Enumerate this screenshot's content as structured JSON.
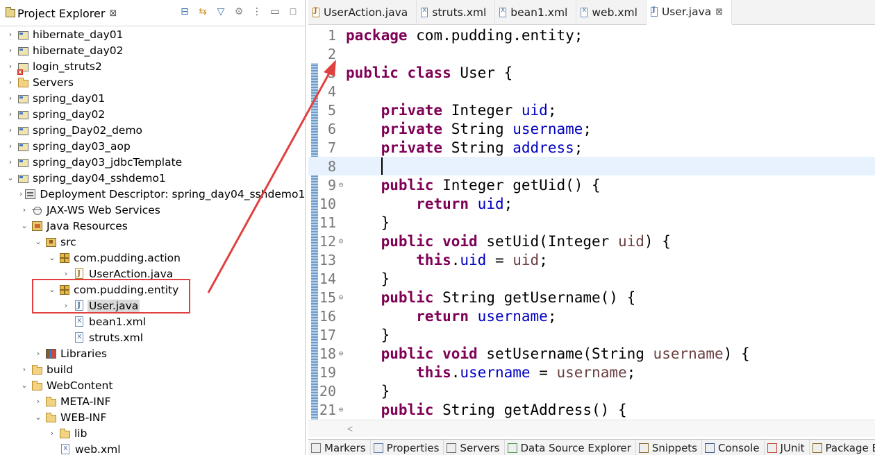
{
  "explorer": {
    "title": "Project Explorer",
    "close": "⊠",
    "tools": [
      "⊟",
      "⇆",
      "▽",
      "⚙",
      "⋮",
      "▭",
      "□"
    ],
    "items": [
      {
        "label": "hibernate_day01",
        "icon": "project",
        "chev": "›"
      },
      {
        "label": "hibernate_day02",
        "icon": "project",
        "chev": "›"
      },
      {
        "label": "login_struts2",
        "icon": "project-error",
        "chev": "›"
      },
      {
        "label": "Servers",
        "icon": "folder",
        "chev": "›"
      },
      {
        "label": "spring_day01",
        "icon": "project",
        "chev": "›"
      },
      {
        "label": "spring_day02",
        "icon": "project",
        "chev": "›"
      },
      {
        "label": "spring_Day02_demo",
        "icon": "project",
        "chev": "›"
      },
      {
        "label": "spring_day03_aop",
        "icon": "project",
        "chev": "›"
      },
      {
        "label": "spring_day03_jdbcTemplate",
        "icon": "project",
        "chev": "›"
      },
      {
        "label": "spring_day04_sshdemo1",
        "icon": "project",
        "chev": "⌄"
      },
      {
        "label": "Deployment Descriptor: spring_day04_sshdemo1",
        "icon": "descriptor",
        "chev": "›"
      },
      {
        "label": "JAX-WS Web Services",
        "icon": "webservice",
        "chev": "›"
      },
      {
        "label": "Java Resources",
        "icon": "java-resources",
        "chev": "⌄"
      },
      {
        "label": "src",
        "icon": "source-folder",
        "chev": "⌄"
      },
      {
        "label": "com.pudding.action",
        "icon": "package",
        "chev": "⌄"
      },
      {
        "label": "UserAction.java",
        "icon": "java-warning",
        "chev": "›"
      },
      {
        "label": "com.pudding.entity",
        "icon": "package",
        "chev": "⌄"
      },
      {
        "label": "User.java",
        "icon": "java",
        "chev": "›"
      },
      {
        "label": "bean1.xml",
        "icon": "xml",
        "chev": ""
      },
      {
        "label": "struts.xml",
        "icon": "xml",
        "chev": ""
      },
      {
        "label": "Libraries",
        "icon": "libraries",
        "chev": "›"
      },
      {
        "label": "build",
        "icon": "folder",
        "chev": "›"
      },
      {
        "label": "WebContent",
        "icon": "folder",
        "chev": "⌄"
      },
      {
        "label": "META-INF",
        "icon": "folder",
        "chev": "›"
      },
      {
        "label": "WEB-INF",
        "icon": "folder",
        "chev": "⌄"
      },
      {
        "label": "lib",
        "icon": "folder",
        "chev": "›"
      },
      {
        "label": "web.xml",
        "icon": "xml",
        "chev": ""
      }
    ]
  },
  "editor": {
    "tabs": [
      {
        "label": "UserAction.java",
        "icon": "java-warning"
      },
      {
        "label": "struts.xml",
        "icon": "xml"
      },
      {
        "label": "bean1.xml",
        "icon": "xml"
      },
      {
        "label": "web.xml",
        "icon": "xml"
      },
      {
        "label": "User.java",
        "icon": "java",
        "active": true,
        "close": "⊠"
      }
    ],
    "lines": [
      {
        "n": "1",
        "fold": "",
        "tokens": [
          [
            "kw",
            "package"
          ],
          [
            "t",
            " com.pudding.entity;"
          ]
        ]
      },
      {
        "n": "2",
        "fold": "",
        "tokens": []
      },
      {
        "n": "3",
        "fold": "",
        "tokens": [
          [
            "kw",
            "public"
          ],
          [
            "t",
            " "
          ],
          [
            "kw",
            "class"
          ],
          [
            "t",
            " User {"
          ]
        ]
      },
      {
        "n": "4",
        "fold": "",
        "tokens": []
      },
      {
        "n": "5",
        "fold": "",
        "tokens": [
          [
            "t",
            "    "
          ],
          [
            "kw",
            "private"
          ],
          [
            "t",
            " Integer "
          ],
          [
            "fld",
            "uid"
          ],
          [
            "t",
            ";"
          ]
        ]
      },
      {
        "n": "6",
        "fold": "",
        "tokens": [
          [
            "t",
            "    "
          ],
          [
            "kw",
            "private"
          ],
          [
            "t",
            " String "
          ],
          [
            "fld",
            "username"
          ],
          [
            "t",
            ";"
          ]
        ]
      },
      {
        "n": "7",
        "fold": "",
        "tokens": [
          [
            "t",
            "    "
          ],
          [
            "kw",
            "private"
          ],
          [
            "t",
            " String "
          ],
          [
            "fld",
            "address"
          ],
          [
            "t",
            ";"
          ]
        ]
      },
      {
        "n": "8",
        "fold": "",
        "current": true,
        "tokens": [
          [
            "t",
            "    "
          ],
          [
            "caret",
            ""
          ]
        ]
      },
      {
        "n": "9",
        "fold": "⊖",
        "tokens": [
          [
            "t",
            "    "
          ],
          [
            "kw",
            "public"
          ],
          [
            "t",
            " Integer getUid() {"
          ]
        ]
      },
      {
        "n": "10",
        "fold": "",
        "tokens": [
          [
            "t",
            "        "
          ],
          [
            "kw",
            "return"
          ],
          [
            "t",
            " "
          ],
          [
            "fld",
            "uid"
          ],
          [
            "t",
            ";"
          ]
        ]
      },
      {
        "n": "11",
        "fold": "",
        "tokens": [
          [
            "t",
            "    }"
          ]
        ]
      },
      {
        "n": "12",
        "fold": "⊖",
        "tokens": [
          [
            "t",
            "    "
          ],
          [
            "kw",
            "public"
          ],
          [
            "t",
            " "
          ],
          [
            "kw",
            "void"
          ],
          [
            "t",
            " setUid(Integer "
          ],
          [
            "prm",
            "uid"
          ],
          [
            "t",
            ") {"
          ]
        ]
      },
      {
        "n": "13",
        "fold": "",
        "tokens": [
          [
            "t",
            "        "
          ],
          [
            "kw",
            "this"
          ],
          [
            "t",
            "."
          ],
          [
            "fld",
            "uid"
          ],
          [
            "t",
            " = "
          ],
          [
            "prm",
            "uid"
          ],
          [
            "t",
            ";"
          ]
        ]
      },
      {
        "n": "14",
        "fold": "",
        "tokens": [
          [
            "t",
            "    }"
          ]
        ]
      },
      {
        "n": "15",
        "fold": "⊖",
        "tokens": [
          [
            "t",
            "    "
          ],
          [
            "kw",
            "public"
          ],
          [
            "t",
            " String getUsername() {"
          ]
        ]
      },
      {
        "n": "16",
        "fold": "",
        "tokens": [
          [
            "t",
            "        "
          ],
          [
            "kw",
            "return"
          ],
          [
            "t",
            " "
          ],
          [
            "fld",
            "username"
          ],
          [
            "t",
            ";"
          ]
        ]
      },
      {
        "n": "17",
        "fold": "",
        "tokens": [
          [
            "t",
            "    }"
          ]
        ]
      },
      {
        "n": "18",
        "fold": "⊖",
        "tokens": [
          [
            "t",
            "    "
          ],
          [
            "kw",
            "public"
          ],
          [
            "t",
            " "
          ],
          [
            "kw",
            "void"
          ],
          [
            "t",
            " setUsername(String "
          ],
          [
            "prm",
            "username"
          ],
          [
            "t",
            ") {"
          ]
        ]
      },
      {
        "n": "19",
        "fold": "",
        "tokens": [
          [
            "t",
            "        "
          ],
          [
            "kw",
            "this"
          ],
          [
            "t",
            "."
          ],
          [
            "fld",
            "username"
          ],
          [
            "t",
            " = "
          ],
          [
            "prm",
            "username"
          ],
          [
            "t",
            ";"
          ]
        ]
      },
      {
        "n": "20",
        "fold": "",
        "tokens": [
          [
            "t",
            "    }"
          ]
        ]
      },
      {
        "n": "21",
        "fold": "⊖",
        "tokens": [
          [
            "t",
            "    "
          ],
          [
            "kw",
            "public"
          ],
          [
            "t",
            " String getAddress() {"
          ]
        ]
      }
    ],
    "scroll_left": "<"
  },
  "bottom": {
    "tabs": [
      "Markers",
      "Properties",
      "Servers",
      "Data Source Explorer",
      "Snippets",
      "Console",
      "JUnit",
      "Package E"
    ]
  },
  "colors": {
    "keyword": "#7f0055",
    "field": "#0000c0",
    "parameter": "#6a3e3e",
    "annotation_red": "#e04040",
    "current_line": "#e8f2fe"
  }
}
